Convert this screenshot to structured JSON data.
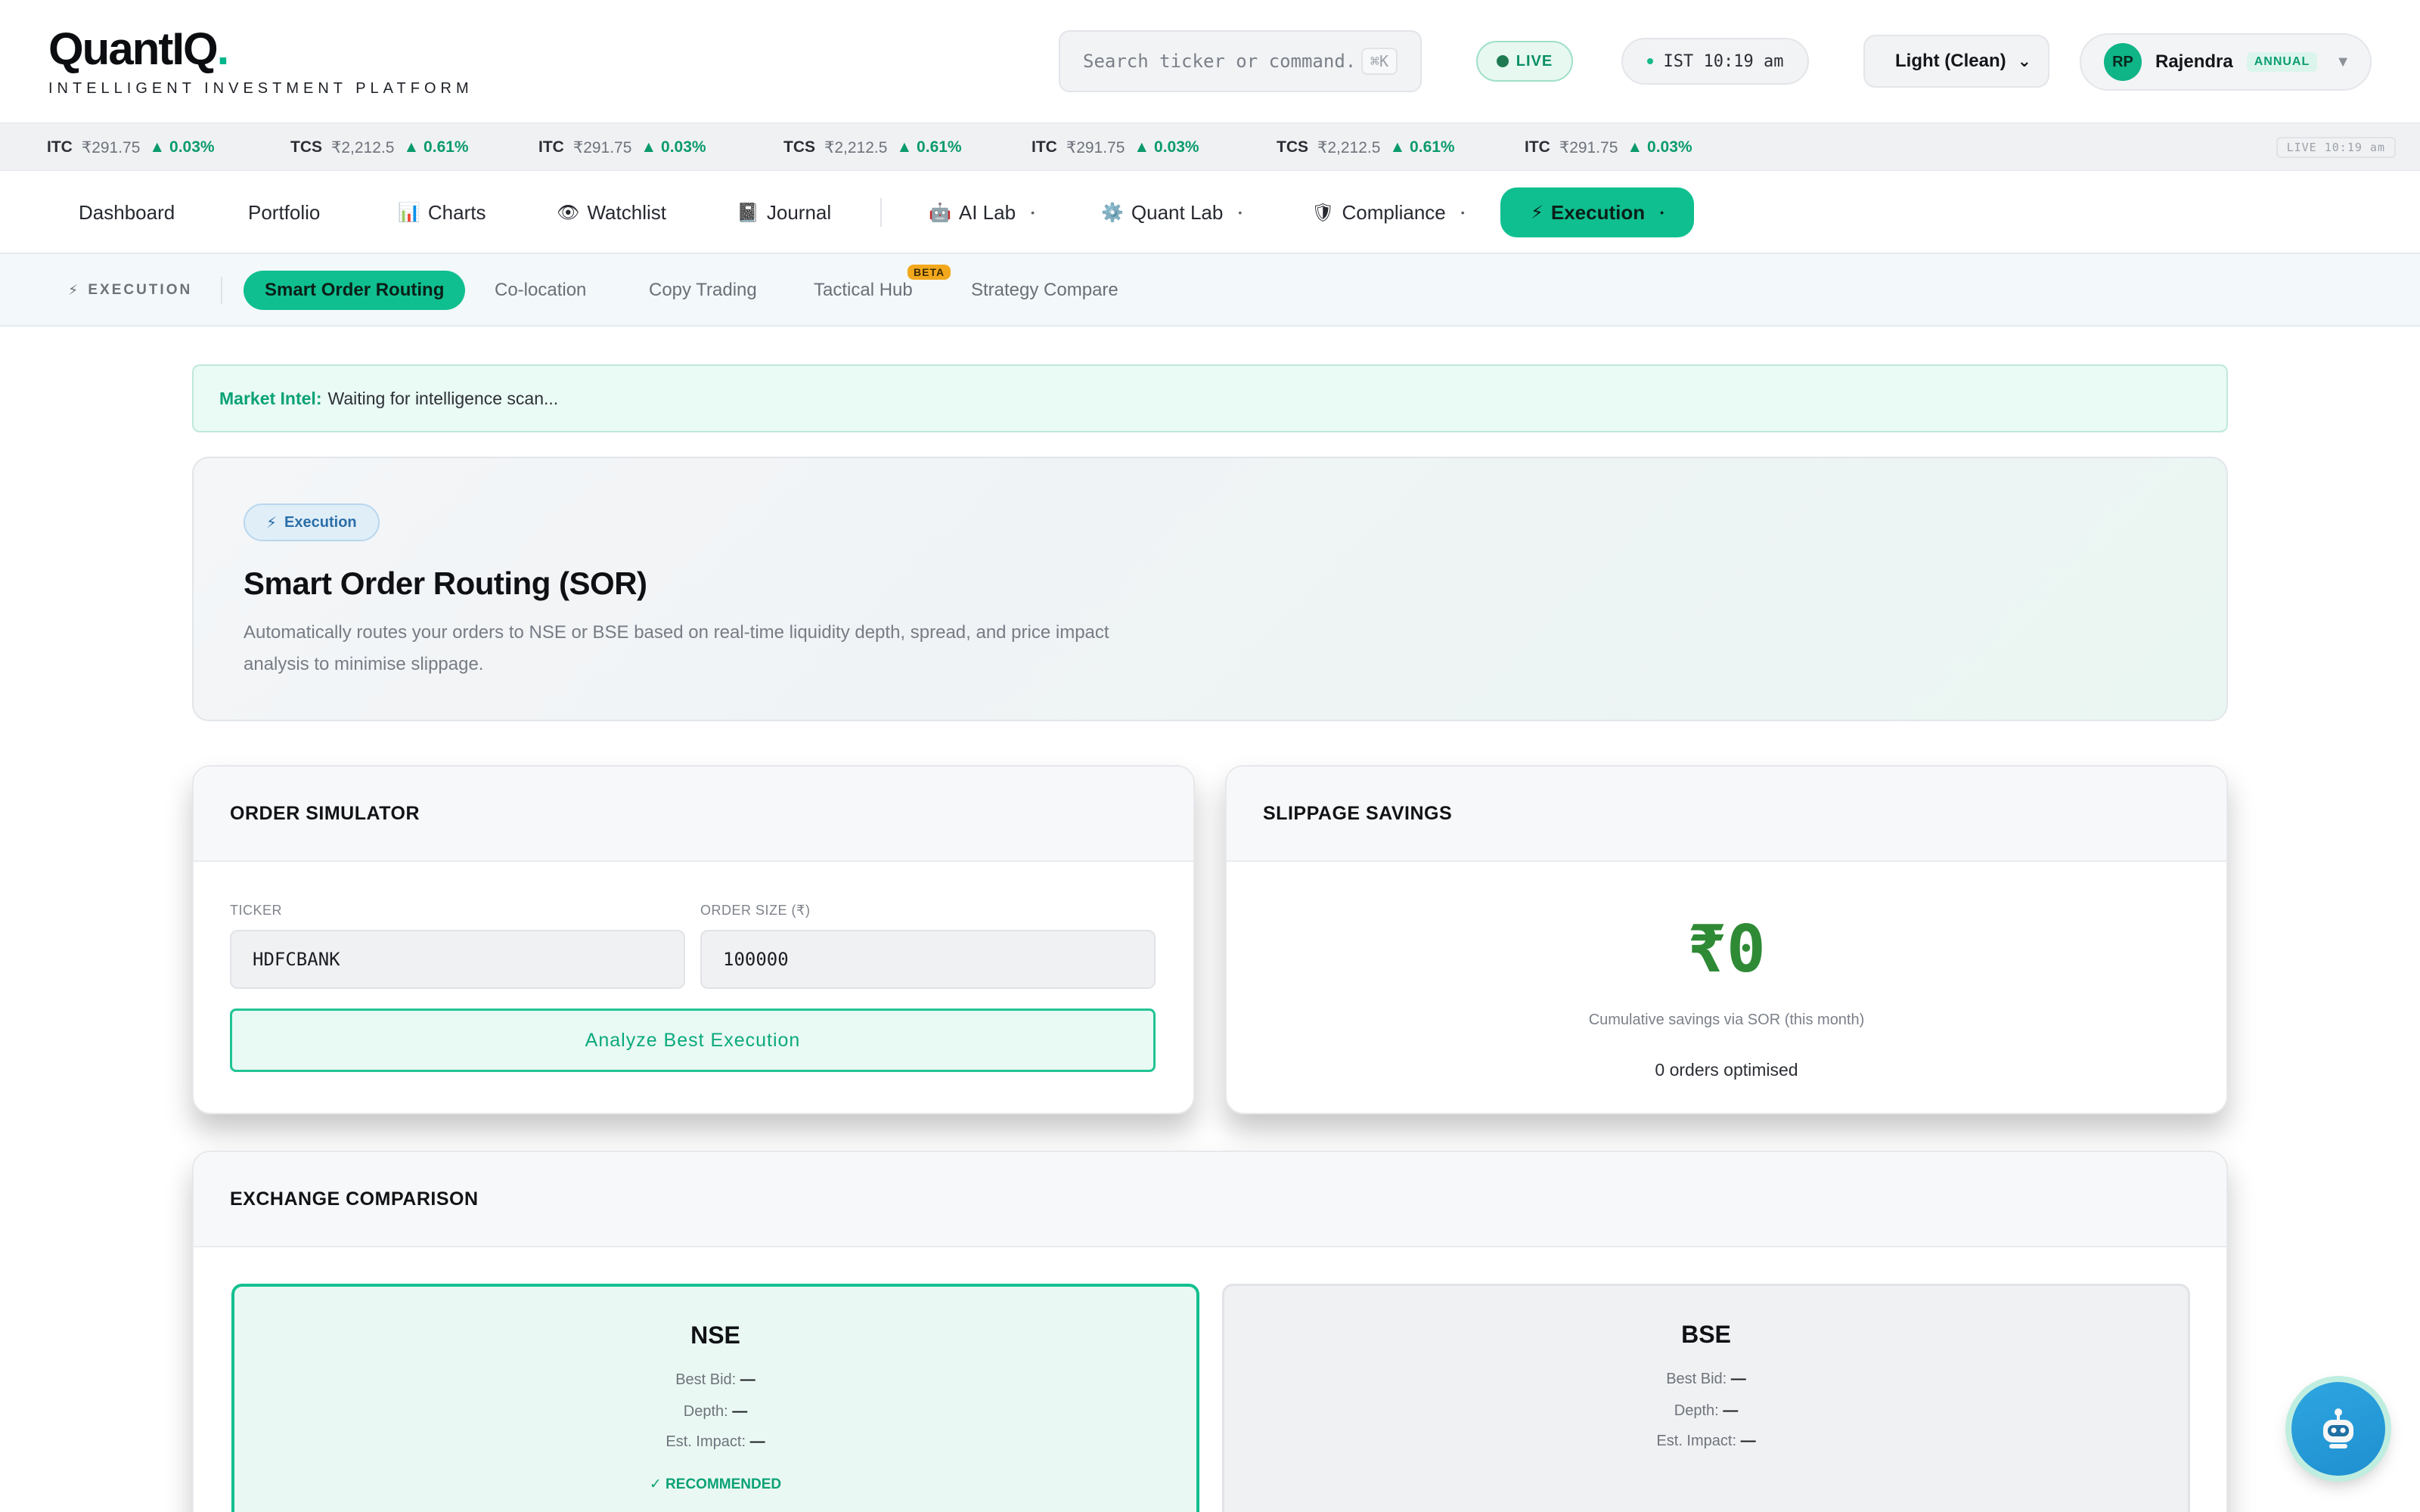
{
  "brand": {
    "logo_main": "QuantIQ",
    "logo_dot": ".",
    "tagline": "INTELLIGENT INVESTMENT PLATFORM"
  },
  "header": {
    "search_placeholder": "Search ticker or command.",
    "search_shortcut": "⌘K",
    "live_label": "LIVE",
    "clock": "IST 10:19 am",
    "theme": "Light (Clean)",
    "user": {
      "initials": "RP",
      "name": "Rajendra",
      "plan": "ANNUAL"
    }
  },
  "ticker": {
    "items": [
      {
        "symbol": "ITC",
        "price": "₹291.75",
        "change": "▲ 0.03%"
      },
      {
        "symbol": "TCS",
        "price": "₹2,212.5",
        "change": "▲ 0.61%"
      },
      {
        "symbol": "ITC",
        "price": "₹291.75",
        "change": "▲ 0.03%"
      },
      {
        "symbol": "TCS",
        "price": "₹2,212.5",
        "change": "▲ 0.61%"
      },
      {
        "symbol": "ITC",
        "price": "₹291.75",
        "change": "▲ 0.03%"
      },
      {
        "symbol": "TCS",
        "price": "₹2,212.5",
        "change": "▲ 0.61%"
      },
      {
        "symbol": "ITC",
        "price": "₹291.75",
        "change": "▲ 0.03%"
      }
    ],
    "live_stamp": "LIVE 10:19 am"
  },
  "nav": {
    "items": [
      {
        "label": "Dashboard",
        "icon": ""
      },
      {
        "label": "Portfolio",
        "icon": ""
      },
      {
        "label": "Charts",
        "icon": "📊"
      },
      {
        "label": "Watchlist",
        "icon": "👁"
      },
      {
        "label": "Journal",
        "icon": "📓"
      },
      {
        "label": "AI Lab",
        "icon": "🤖",
        "dropdown": "•"
      },
      {
        "label": "Quant Lab",
        "icon": "⚙️",
        "dropdown": "•"
      },
      {
        "label": "Compliance",
        "icon": "🛡",
        "dropdown": "•"
      },
      {
        "label": "Execution",
        "icon": "⚡",
        "dropdown": "•",
        "active": true
      }
    ]
  },
  "subnav": {
    "section_label": "EXECUTION",
    "section_icon": "⚡",
    "items": [
      {
        "label": "Smart Order Routing",
        "active": true
      },
      {
        "label": "Co-location"
      },
      {
        "label": "Copy Trading"
      },
      {
        "label": "Tactical Hub",
        "badge": "BETA"
      },
      {
        "label": "Strategy Compare"
      }
    ]
  },
  "intel": {
    "label": "Market Intel:",
    "text": "Waiting for intelligence scan..."
  },
  "hero": {
    "badge": "Execution",
    "badge_icon": "⚡",
    "title": "Smart Order Routing (SOR)",
    "description": "Automatically routes your orders to NSE or BSE based on real-time liquidity depth, spread, and price impact analysis to minimise slippage."
  },
  "order_simulator": {
    "title": "ORDER SIMULATOR",
    "ticker_label": "TICKER",
    "ticker_value": "HDFCBANK",
    "size_label": "ORDER SIZE (₹)",
    "size_value": "100000",
    "button": "Analyze Best Execution"
  },
  "slippage": {
    "title": "SLIPPAGE SAVINGS",
    "amount": "₹0",
    "caption": "Cumulative savings via SOR (this month)",
    "orders": "0 orders optimised"
  },
  "exchange": {
    "title": "EXCHANGE COMPARISON",
    "nse": {
      "name": "NSE",
      "best_bid_label": "Best Bid:",
      "best_bid": "—",
      "depth_label": "Depth:",
      "depth": "—",
      "impact_label": "Est. Impact:",
      "impact": "—",
      "recommended": "✓ RECOMMENDED"
    },
    "bse": {
      "name": "BSE",
      "best_bid_label": "Best Bid:",
      "best_bid": "—",
      "depth_label": "Depth:",
      "depth": "—",
      "impact_label": "Est. Impact:",
      "impact": "—"
    }
  },
  "colors": {
    "accent": "#0fbf8f",
    "positive": "#0a9b6b",
    "savings": "#2f8a36"
  }
}
